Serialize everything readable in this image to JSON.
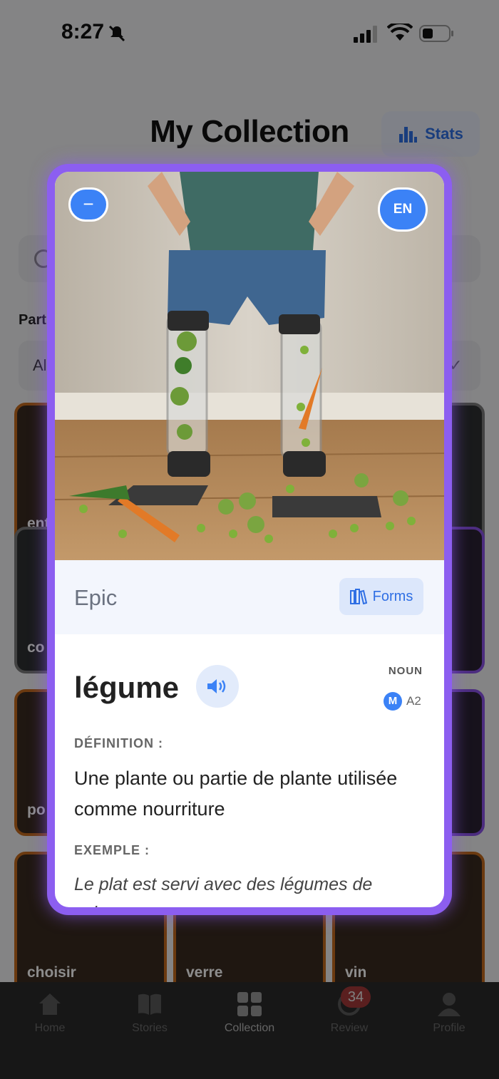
{
  "status_bar": {
    "time": "8:27"
  },
  "header": {
    "title": "My Collection",
    "stats_label": "Stats"
  },
  "background": {
    "part_label": "Part",
    "select_value": "Al",
    "tiles": [
      {
        "label": "ent",
        "border": "orange"
      },
      {
        "label": "",
        "border": "orange"
      },
      {
        "label": "",
        "border": "gray"
      },
      {
        "label": "co",
        "border": "gray"
      },
      {
        "label": "",
        "border": "orange"
      },
      {
        "label": "",
        "border": "purple"
      },
      {
        "label": "po",
        "border": "orange"
      },
      {
        "label": "",
        "border": "orange"
      },
      {
        "label": "",
        "border": "purple"
      },
      {
        "label": "choisir",
        "border": "orange"
      },
      {
        "label": "verre",
        "border": "orange"
      },
      {
        "label": "vin",
        "border": "orange"
      }
    ]
  },
  "tabbar": {
    "items": [
      {
        "label": "Home",
        "icon": "home-icon"
      },
      {
        "label": "Stories",
        "icon": "book-icon"
      },
      {
        "label": "Collection",
        "icon": "grid-icon"
      },
      {
        "label": "Review",
        "icon": "review-icon"
      },
      {
        "label": "Profile",
        "icon": "person-icon"
      }
    ],
    "review_badge": "34"
  },
  "card": {
    "minus_label": "−",
    "language_label": "EN",
    "rarity": "Epic",
    "forms_label": "Forms",
    "word": "légume",
    "part_of_speech": "NOUN",
    "gender": "M",
    "level": "A2",
    "definition_label": "DÉFINITION :",
    "definition": "Une plante ou partie de plante utilisée comme nourriture",
    "example_label": "EXEMPLE :",
    "example": "Le plat est servi avec des légumes de saison"
  },
  "colors": {
    "accent": "#3b82f6",
    "card_border": "#8c5ef0",
    "rarity_bg": "#f3f6fd"
  }
}
